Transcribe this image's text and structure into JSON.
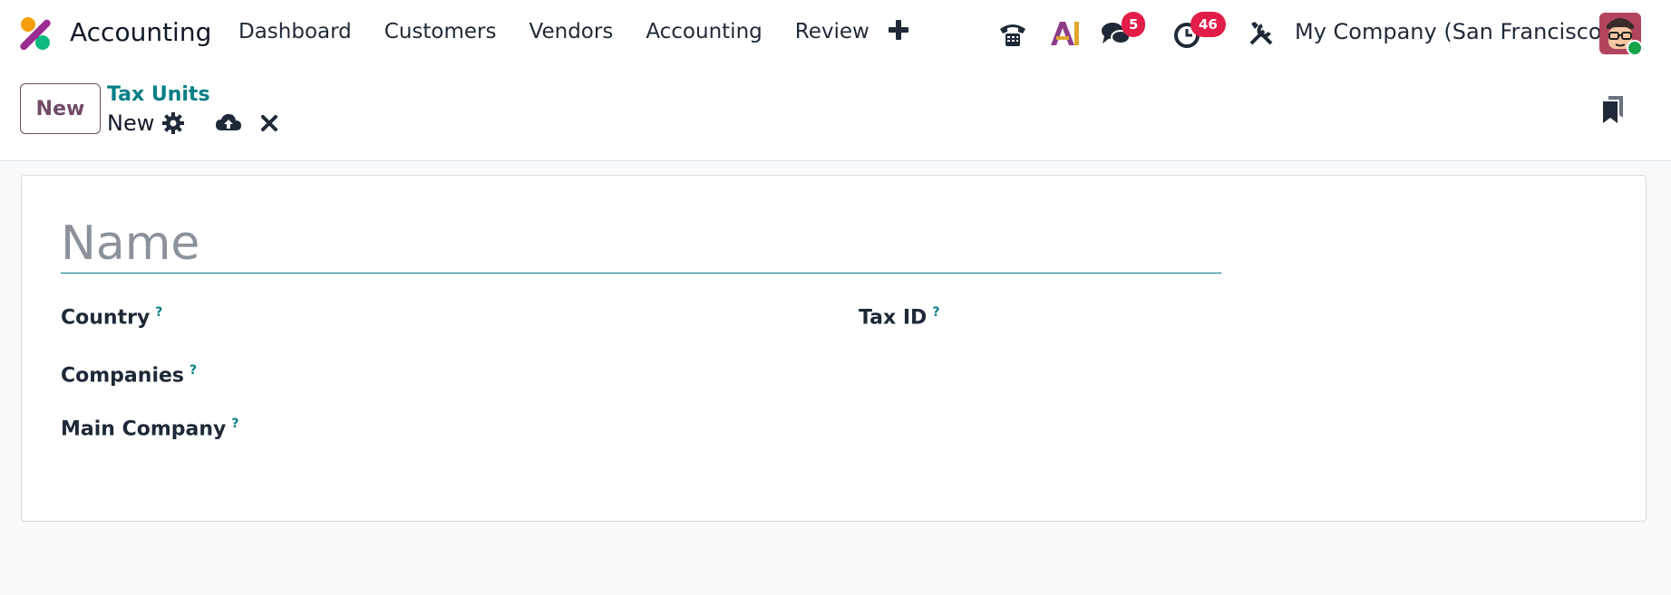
{
  "app": {
    "name": "Accounting"
  },
  "menu": {
    "items": [
      {
        "label": "Dashboard"
      },
      {
        "label": "Customers"
      },
      {
        "label": "Vendors"
      },
      {
        "label": "Accounting"
      },
      {
        "label": "Review"
      }
    ]
  },
  "systray": {
    "messages_count": "5",
    "activities_count": "46",
    "company": "My Company (San Francisco)"
  },
  "control_panel": {
    "new_label": "New",
    "breadcrumb_parent": "Tax Units",
    "breadcrumb_current": "New"
  },
  "form": {
    "name_placeholder": "Name",
    "name_value": "",
    "fields": {
      "country": "Country",
      "tax_id": "Tax ID",
      "companies": "Companies",
      "main_company": "Main Company"
    },
    "help_glyph": "?"
  },
  "colors": {
    "brand": "#714b67",
    "accent": "#017e84",
    "badge": "#e11d48",
    "online": "#16a34a"
  },
  "icons": [
    "app-logo-icon",
    "plus-icon",
    "phone-icon",
    "ai-icon",
    "chat-icon",
    "clock-icon",
    "tools-icon",
    "gear-icon",
    "cloud-upload-icon",
    "close-icon",
    "bookmark-icon"
  ]
}
